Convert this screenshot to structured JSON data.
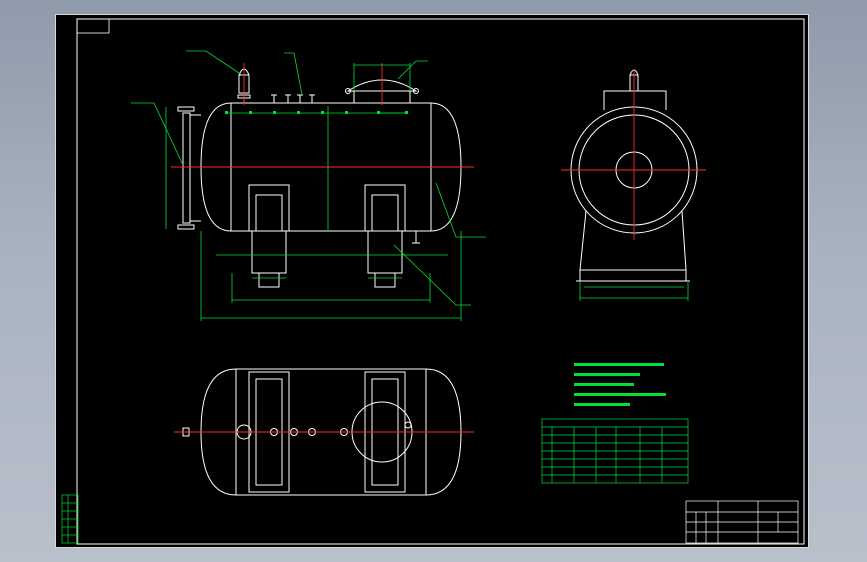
{
  "drawing": {
    "background": "#000000",
    "line_color": "#ffffff",
    "accent_color": "#ff2a2a",
    "dimension_color": "#00e030",
    "table_color": "#00e030"
  },
  "front_view": {
    "labels": {
      "vent_valve": "",
      "nozzle_a": "",
      "manhole": "",
      "level_gauge": "",
      "saddle_note": "",
      "corrosion_note": ""
    },
    "dimensions": {
      "manhole_width": "",
      "diameter": "",
      "saddle_spacing": "",
      "saddle_width_left": "",
      "saddle_width_right": "",
      "straight_length": "",
      "overall_length": ""
    }
  },
  "side_view": {
    "dimensions": {
      "saddle_base": "",
      "overall_width": ""
    }
  },
  "plan_view": {
    "label_nozzle": ""
  },
  "technical_requirements": {
    "heading": "",
    "items": [
      "",
      "",
      "",
      "",
      ""
    ]
  },
  "nozzle_table": {
    "title": "",
    "rows": 6,
    "cols": 7
  },
  "title_block": {
    "project": "",
    "drawing_name": "",
    "company": ""
  },
  "revision_block": {
    "rows": 6
  }
}
